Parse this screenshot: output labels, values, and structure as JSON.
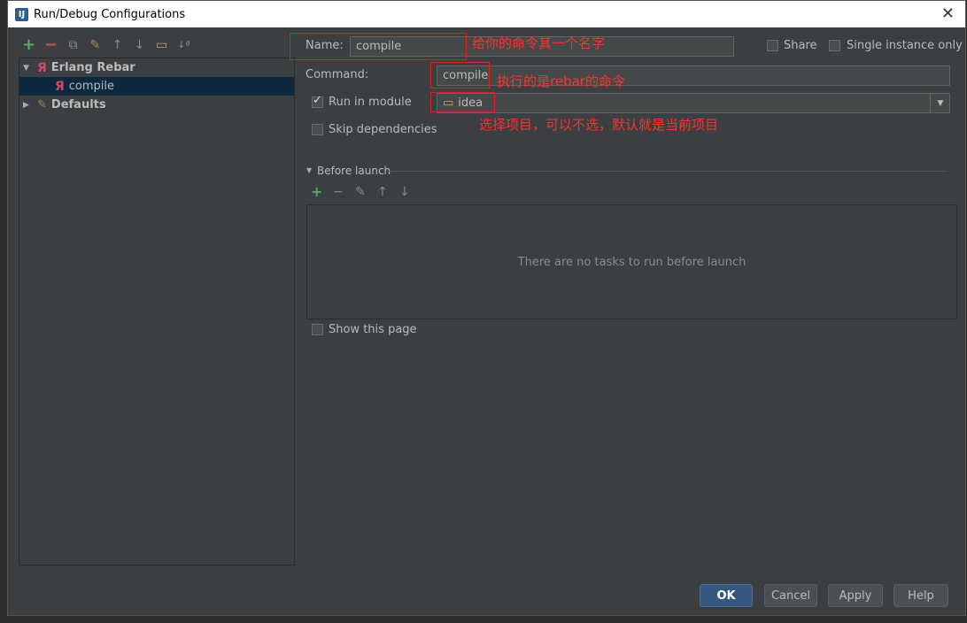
{
  "window": {
    "title": "Run/Debug Configurations",
    "icon": "intellij-icon",
    "close": "✕"
  },
  "toolbar": {
    "icons": [
      "add-icon",
      "remove-icon",
      "copy-icon",
      "wrench-icon",
      "arrow-up-icon",
      "arrow-down-icon",
      "folder-icon",
      "sort-icon"
    ]
  },
  "tree": {
    "group1": "Erlang Rebar",
    "item1": "compile",
    "group2": "Defaults"
  },
  "form": {
    "name_label": "Name:",
    "name_value": "compile",
    "share_label": "Share",
    "single_instance_label": "Single instance only",
    "command_label": "Command:",
    "command_value": "compile",
    "run_in_module_label": "Run in module",
    "module_value": "idea",
    "skip_deps_label": "Skip dependencies",
    "before_launch_label": "Before launch",
    "no_tasks_text": "There are no tasks to run before launch",
    "show_page_label": "Show this page"
  },
  "annotations": {
    "name_note": "给你的命令其一个名字",
    "command_note": "执行的是rebar的命令",
    "module_note": "选择项目，可以不选，默认就是当前项目"
  },
  "buttons": {
    "ok": "OK",
    "cancel": "Cancel",
    "apply": "Apply",
    "help": "Help"
  },
  "colors": {
    "accent": "#365880",
    "annotation": "#ff3030",
    "selection": "#0d293e"
  }
}
